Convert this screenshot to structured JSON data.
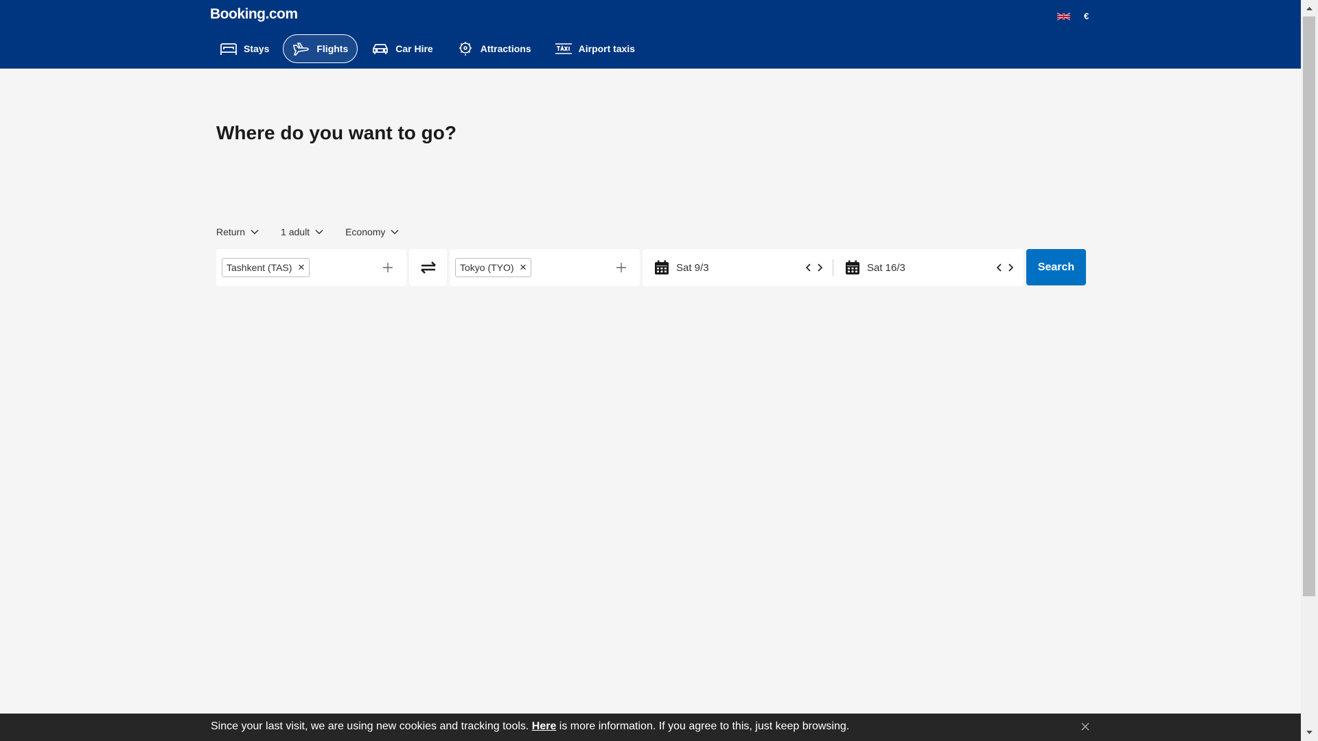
{
  "header": {
    "logo": "Booking.com",
    "currency": "€",
    "nav": [
      {
        "label": "Stays",
        "icon": "bed-icon"
      },
      {
        "label": "Flights",
        "icon": "plane-icon",
        "active": true
      },
      {
        "label": "Car Hire",
        "icon": "car-icon"
      },
      {
        "label": "Attractions",
        "icon": "attractions-icon"
      },
      {
        "label": "Airport taxis",
        "icon": "taxi-icon"
      }
    ]
  },
  "main": {
    "headline": "Where do you want to go?",
    "options": {
      "trip_type": "Return",
      "travellers": "1 adult",
      "cabin_class": "Economy"
    },
    "search": {
      "origin": "Tashkent (TAS)",
      "destination": "Tokyo (TYO)",
      "depart_date": "Sat 9/3",
      "return_date": "Sat 16/3",
      "button_label": "Search"
    }
  },
  "cookie_bar": {
    "text_before": "Since your last visit, we are using new cookies and tracking tools. ",
    "link": "Here",
    "text_after": " is more information. If you agree to this, just keep browsing."
  },
  "colors": {
    "header_bg": "#003580",
    "primary_button": "#0071c2",
    "page_bg": "#f5f5f5",
    "cookie_bg": "#262626"
  }
}
